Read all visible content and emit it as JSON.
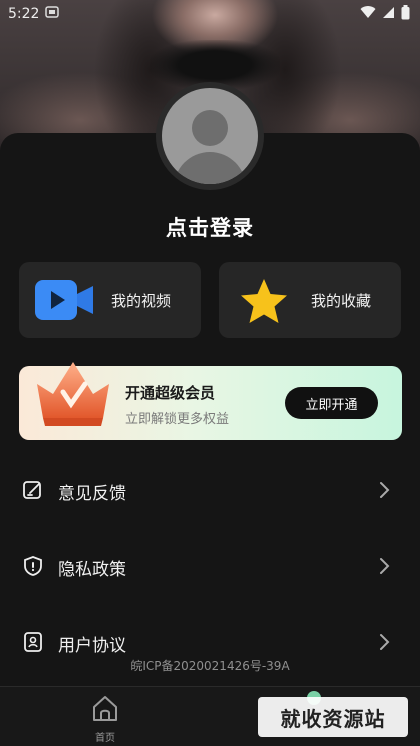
{
  "status_bar": {
    "time": "5:22"
  },
  "profile": {
    "login_prompt": "点击登录"
  },
  "cards": {
    "videos_label": "我的视频",
    "favorites_label": "我的收藏"
  },
  "vip": {
    "title": "开通超级会员",
    "subtitle": "立即解锁更多权益",
    "button": "立即开通"
  },
  "menu": [
    {
      "label": "意见反馈",
      "icon": "feedback-edit-icon"
    },
    {
      "label": "隐私政策",
      "icon": "shield-icon"
    },
    {
      "label": "用户协议",
      "icon": "agreement-icon"
    }
  ],
  "footer": {
    "icp": "皖ICP备2020021426号-39A"
  },
  "tabbar": {
    "home_label": "首页"
  },
  "watermark": "就收资源站",
  "colors": {
    "video_icon": "#3b8bf5",
    "star": "#f7c21b",
    "vip_button": "#111111"
  }
}
